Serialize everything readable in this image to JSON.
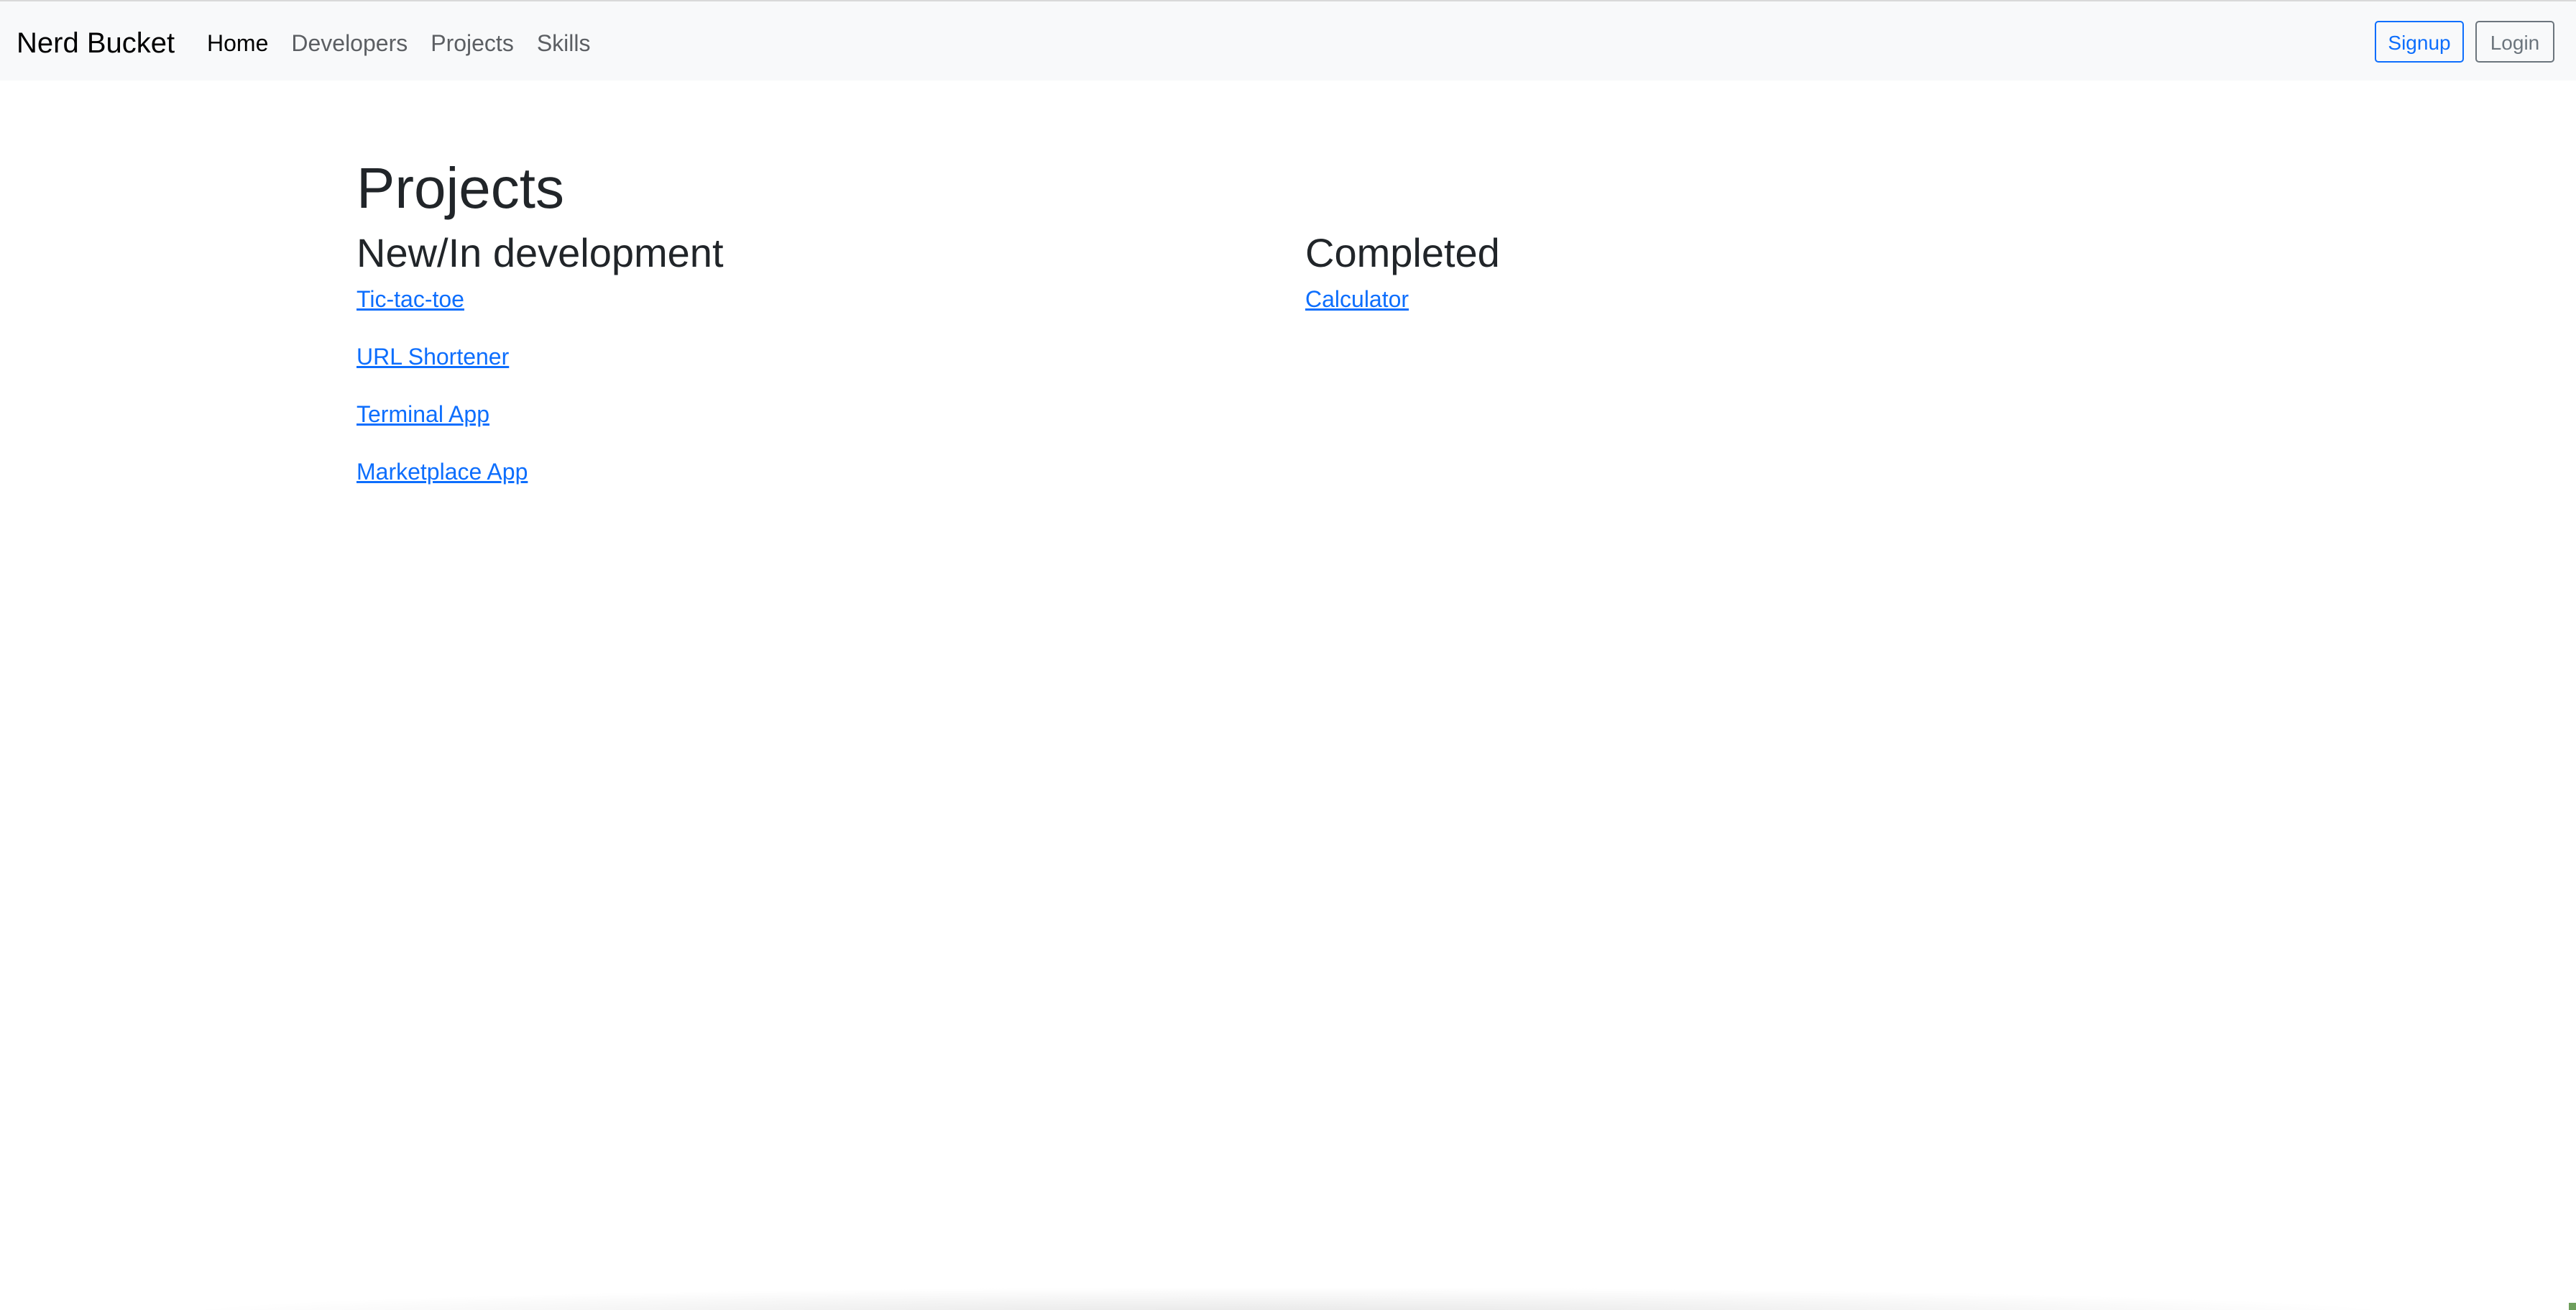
{
  "navbar": {
    "brand": "Nerd Bucket",
    "links": [
      {
        "label": "Home",
        "active": true
      },
      {
        "label": "Developers",
        "active": false
      },
      {
        "label": "Projects",
        "active": false
      },
      {
        "label": "Skills",
        "active": false
      }
    ],
    "signup_label": "Signup",
    "login_label": "Login"
  },
  "page": {
    "title": "Projects",
    "in_development": {
      "heading": "New/In development",
      "projects": [
        "Tic-tac-toe",
        "URL Shortener",
        "Terminal App",
        "Marketplace App"
      ]
    },
    "completed": {
      "heading": "Completed",
      "projects": [
        "Calculator"
      ]
    }
  },
  "colors": {
    "navbar_bg": "#f8f9fa",
    "link": "#0d6efd",
    "text": "#212529",
    "nav_muted": "#5c5f63",
    "login_border": "#6c757d"
  }
}
